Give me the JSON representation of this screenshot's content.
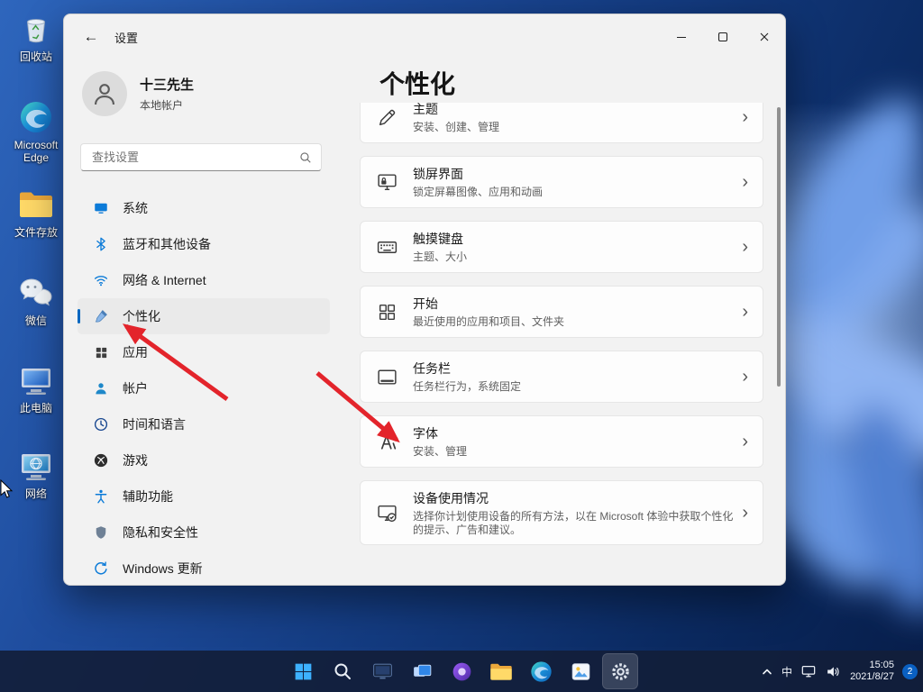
{
  "glyphs": {
    "back_arrow": "←",
    "chevron_right": "›"
  },
  "colors": {
    "accent": "#0067c0",
    "annotation_red": "#e3242b",
    "taskbar_bg": "#121e3a"
  },
  "desktop": {
    "icons": [
      {
        "label": "回收站"
      },
      {
        "label": "Microsoft Edge"
      },
      {
        "label": "文件存放"
      },
      {
        "label": "微信"
      },
      {
        "label": "此电脑"
      },
      {
        "label": "网络"
      }
    ]
  },
  "settings_window": {
    "title": "设置",
    "user": {
      "name": "十三先生",
      "account_type": "本地帐户"
    },
    "search": {
      "placeholder": "查找设置"
    },
    "nav": [
      {
        "label": "系统"
      },
      {
        "label": "蓝牙和其他设备"
      },
      {
        "label": "网络 & Internet"
      },
      {
        "label": "个性化"
      },
      {
        "label": "应用"
      },
      {
        "label": "帐户"
      },
      {
        "label": "时间和语言"
      },
      {
        "label": "游戏"
      },
      {
        "label": "辅助功能"
      },
      {
        "label": "隐私和安全性"
      },
      {
        "label": "Windows 更新"
      }
    ],
    "page_title": "个性化",
    "cards": [
      {
        "title": "主题",
        "desc": "安装、创建、管理"
      },
      {
        "title": "锁屏界面",
        "desc": "锁定屏幕图像、应用和动画"
      },
      {
        "title": "触摸键盘",
        "desc": "主题、大小"
      },
      {
        "title": "开始",
        "desc": "最近使用的应用和项目、文件夹"
      },
      {
        "title": "任务栏",
        "desc": "任务栏行为，系统固定"
      },
      {
        "title": "字体",
        "desc": "安装、管理"
      },
      {
        "title": "设备使用情况",
        "desc": "选择你计划使用设备的所有方法，以在 Microsoft 体验中获取个性化的提示、广告和建议。"
      }
    ]
  },
  "taskbar": {
    "ime_label": "中",
    "clock": {
      "time": "15:05",
      "date": "2021/8/27"
    },
    "notification_count": "2"
  },
  "annotations": {
    "arrow_1_target": "个性化",
    "arrow_2_target": "字体"
  }
}
